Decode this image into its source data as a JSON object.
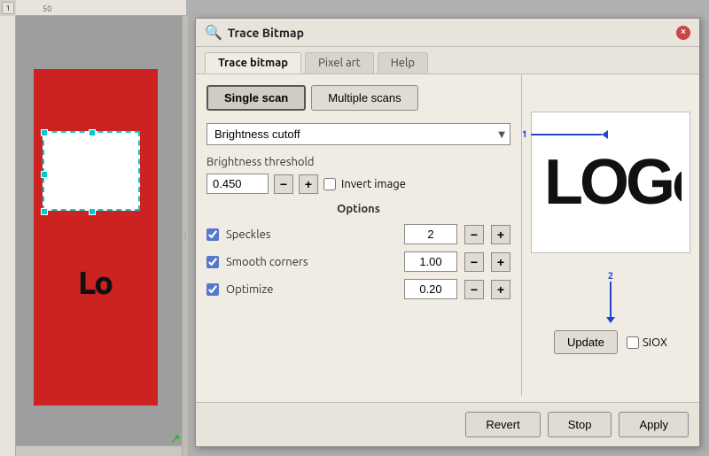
{
  "dialog": {
    "title": "Trace Bitmap",
    "tabs": [
      {
        "id": "trace-bitmap",
        "label": "Trace bitmap",
        "active": true
      },
      {
        "id": "pixel-art",
        "label": "Pixel art",
        "active": false
      },
      {
        "id": "help",
        "label": "Help",
        "active": false
      }
    ],
    "scan_buttons": [
      {
        "id": "single-scan",
        "label": "Single scan",
        "active": true
      },
      {
        "id": "multiple-scans",
        "label": "Multiple scans",
        "active": false
      }
    ],
    "dropdown": {
      "label": "Brightness cutoff",
      "value": "Brightness cutoff"
    },
    "brightness_threshold": {
      "label": "Brightness threshold",
      "value": "0.450"
    },
    "invert_image": {
      "label": "Invert image",
      "checked": false
    },
    "options": {
      "title": "Options",
      "items": [
        {
          "label": "Speckles",
          "value": "2",
          "checked": true
        },
        {
          "label": "Smooth corners",
          "value": "1.00",
          "checked": true
        },
        {
          "label": "Optimize",
          "value": "0.20",
          "checked": true
        }
      ]
    },
    "update_button": "Update",
    "siox_label": "SIOX",
    "footer_buttons": [
      {
        "id": "revert",
        "label": "Revert"
      },
      {
        "id": "stop",
        "label": "Stop"
      },
      {
        "id": "apply",
        "label": "Apply"
      }
    ],
    "annotation_1_number": "1",
    "annotation_2_number": "2",
    "logo_preview": "LOGo"
  },
  "canvas": {
    "page_indicator": "1"
  },
  "icons": {
    "trace_icon": "🔍",
    "close_icon": "×",
    "dropdown_arrow": "▼",
    "stepper_minus": "−",
    "stepper_plus": "+"
  }
}
